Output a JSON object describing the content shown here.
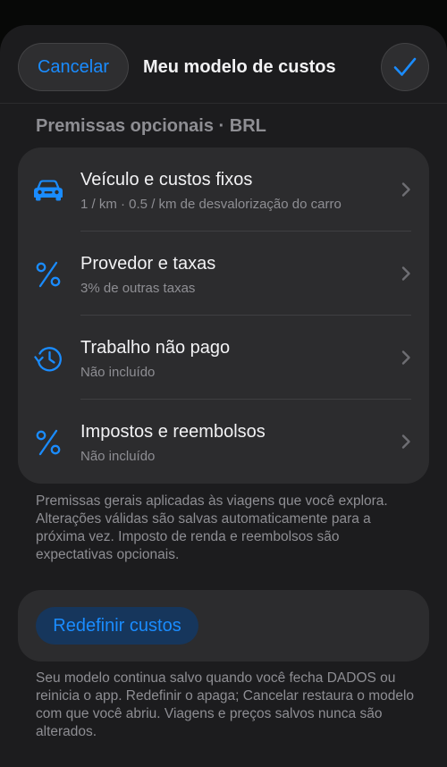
{
  "nav": {
    "cancel_label": "Cancelar",
    "title": "Meu modelo de custos",
    "done_icon": "checkmark-icon"
  },
  "section": {
    "header": "Premissas opcionais · BRL",
    "rows": [
      {
        "icon": "car-icon",
        "title": "Veículo e custos fixos",
        "subtitle": "1 / km · 0.5 / km de desvalorização do carro"
      },
      {
        "icon": "percent-icon",
        "title": "Provedor e taxas",
        "subtitle": "3% de outras taxas"
      },
      {
        "icon": "history-clock-icon",
        "title": "Trabalho não pago",
        "subtitle": "Não incluído"
      },
      {
        "icon": "percent-icon",
        "title": "Impostos e reembolsos",
        "subtitle": "Não incluído"
      }
    ],
    "footer": "Premissas gerais aplicadas às viagens que você explora. Alterações válidas são salvas automaticamente para a próxima vez. Imposto de renda e reembolsos são expectativas opcionais."
  },
  "reset": {
    "button_label": "Redefinir custos",
    "footer": "Seu modelo continua salvo quando você fecha DADOS ou reinicia o app. Redefinir o apaga; Cancelar restaura o modelo com que você abriu. Viagens e preços salvos nunca são alterados."
  },
  "colors": {
    "accent": "#1a8cff",
    "background": "#1c1c1e",
    "card": "#2c2c2e",
    "secondary_text": "#8e8e93"
  }
}
